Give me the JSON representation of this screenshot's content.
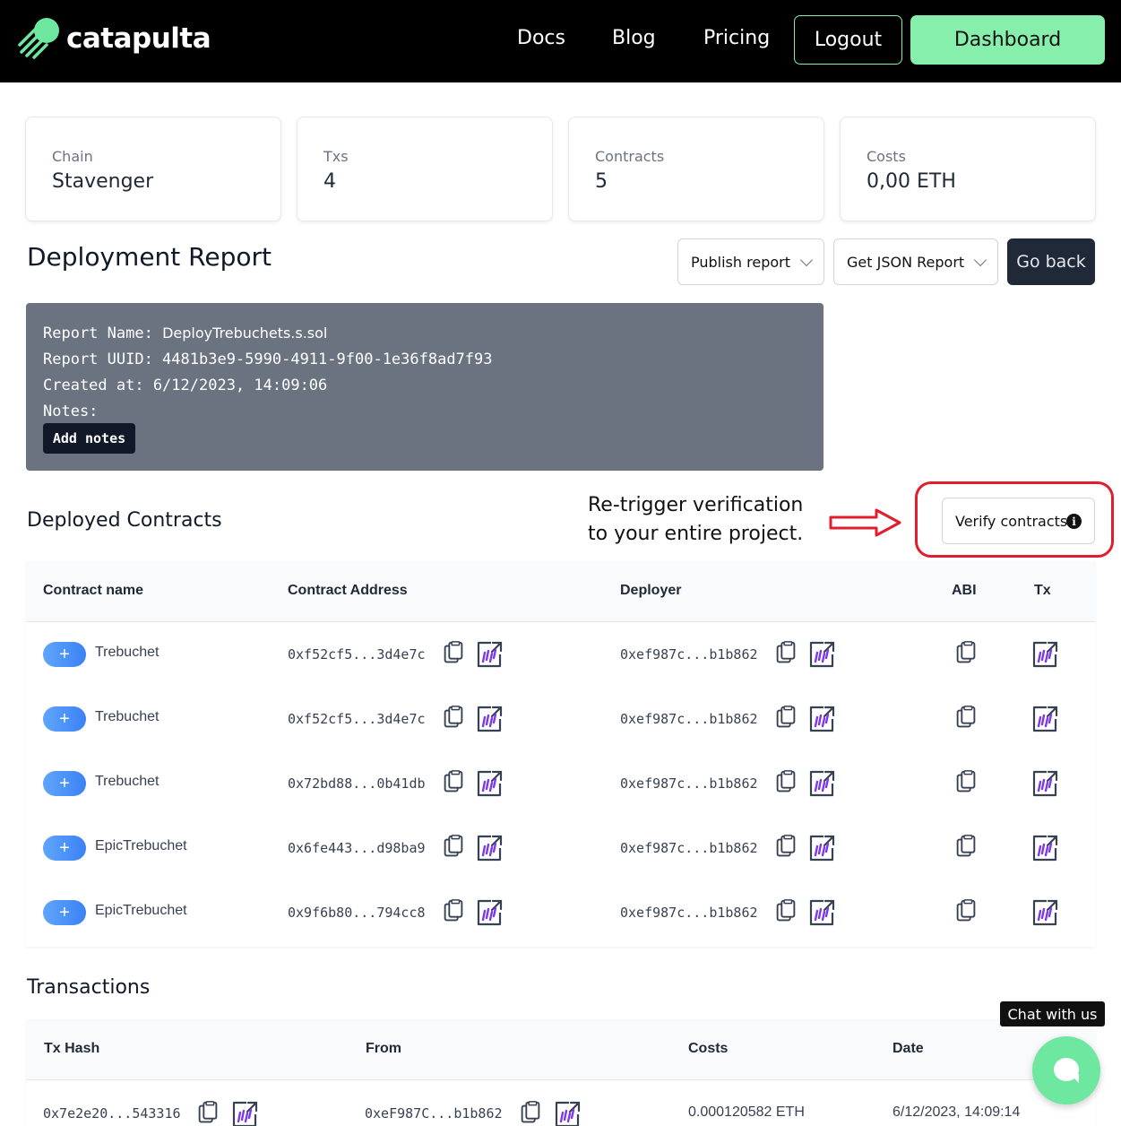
{
  "header": {
    "brand": "catapulta",
    "nav": [
      "Docs",
      "Blog",
      "Pricing"
    ],
    "logout_label": "Logout",
    "dashboard_label": "Dashboard"
  },
  "stats": [
    {
      "label": "Chain",
      "value": "Stavenger"
    },
    {
      "label": "Txs",
      "value": "4"
    },
    {
      "label": "Contracts",
      "value": "5"
    },
    {
      "label": "Costs",
      "value": "0,00 ETH"
    }
  ],
  "page_title": "Deployment Report",
  "actions": {
    "publish_label": "Publish report",
    "json_label": "Get JSON Report",
    "back_label": "Go back"
  },
  "report": {
    "name_label": "Report Name:",
    "name_value": "DeployTrebuchets.s.sol",
    "uuid_line": "Report UUID: 4481b3e9-5990-4911-9f00-1e36f8ad7f93",
    "created_line": "Created at: 6/12/2023, 14:09:06",
    "notes_line": "Notes:",
    "add_notes_label": "Add notes"
  },
  "deployed": {
    "title": "Deployed Contracts",
    "annotation_line1": "Re-trigger verification",
    "annotation_line2": "to your entire project.",
    "verify_label": "Verify contracts",
    "info_glyph": "i",
    "columns": [
      "Contract name",
      "Contract Address",
      "Deployer",
      "ABI",
      "Tx"
    ],
    "rows": [
      {
        "name": "Trebuchet",
        "address": "0xf52cf5...3d4e7c",
        "deployer": "0xef987c...b1b862"
      },
      {
        "name": "Trebuchet",
        "address": "0xf52cf5...3d4e7c",
        "deployer": "0xef987c...b1b862"
      },
      {
        "name": "Trebuchet",
        "address": "0x72bd88...0b41db",
        "deployer": "0xef987c...b1b862"
      },
      {
        "name": "EpicTrebuchet",
        "address": "0x6fe443...d98ba9",
        "deployer": "0xef987c...b1b862"
      },
      {
        "name": "EpicTrebuchet",
        "address": "0x9f6b80...794cc8",
        "deployer": "0xef987c...b1b862"
      }
    ]
  },
  "transactions": {
    "title": "Transactions",
    "columns": [
      "Tx Hash",
      "From",
      "Costs",
      "Date"
    ],
    "rows": [
      {
        "hash": "0x7e2e20...543316",
        "from": "0xeF987C...b1b862",
        "cost": "0.000120582 ETH",
        "date": "6/12/2023, 14:09:14"
      }
    ]
  },
  "chat": {
    "label": "Chat with us"
  },
  "colors": {
    "accent_green": "#86efac",
    "dark": "#1f2937",
    "annotation_red": "#e11d2e",
    "etherscan_purple": "#7c3aed"
  },
  "icons": {
    "copy": "clipboard-copy-icon",
    "explorer": "explorer-link-icon",
    "expand": "plus-icon"
  }
}
